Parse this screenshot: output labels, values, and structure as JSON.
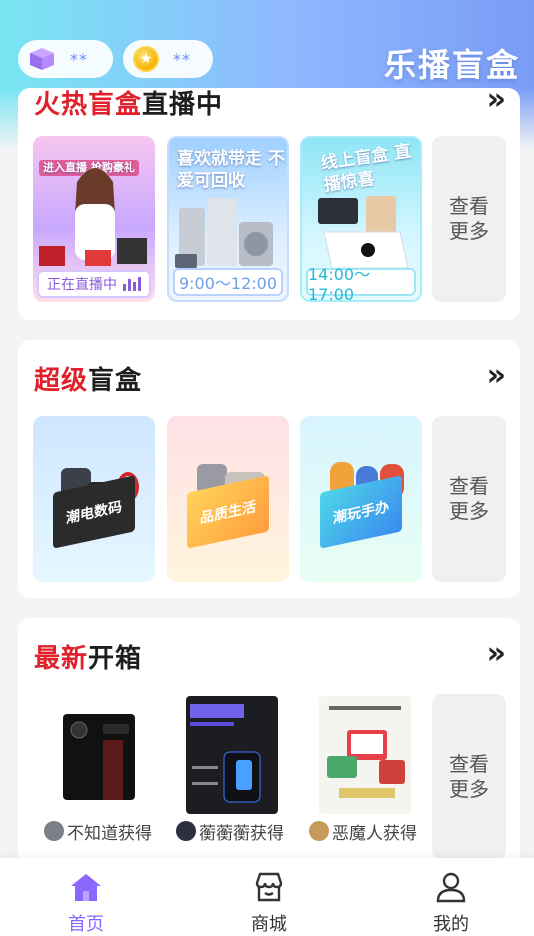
{
  "header": {
    "brand": "乐播盲盒",
    "box_count": "**",
    "coin_count": "**"
  },
  "live_section": {
    "title_red": "火热盲盒",
    "title_dark": "直播中",
    "tiles": [
      {
        "caption": "进入直播 抢购豪礼",
        "status": "正在直播中"
      },
      {
        "caption": "喜欢就带走 不爱可回收",
        "status": "9:00～12:00"
      },
      {
        "caption": "线上盲盒 直播惊喜",
        "status": "14:00～17:00"
      }
    ],
    "see_more": [
      "查看",
      "更多"
    ]
  },
  "super_section": {
    "title_red": "超级",
    "title_dark": "盲盒",
    "tiles": [
      {
        "label": "潮电数码"
      },
      {
        "label": "品质生活"
      },
      {
        "label": "潮玩手办"
      }
    ],
    "see_more": [
      "查看",
      "更多"
    ]
  },
  "unbox_section": {
    "title_red": "最新",
    "title_dark": "开箱",
    "items": [
      {
        "winner": "不知道获得"
      },
      {
        "winner": "蘅蘅蘅获得"
      },
      {
        "winner": "恶魔人获得"
      }
    ],
    "see_more": [
      "查看",
      "更多"
    ]
  },
  "tabbar": {
    "home": "首页",
    "shop": "商城",
    "mine": "我的",
    "active_color": "#8a67ff"
  }
}
